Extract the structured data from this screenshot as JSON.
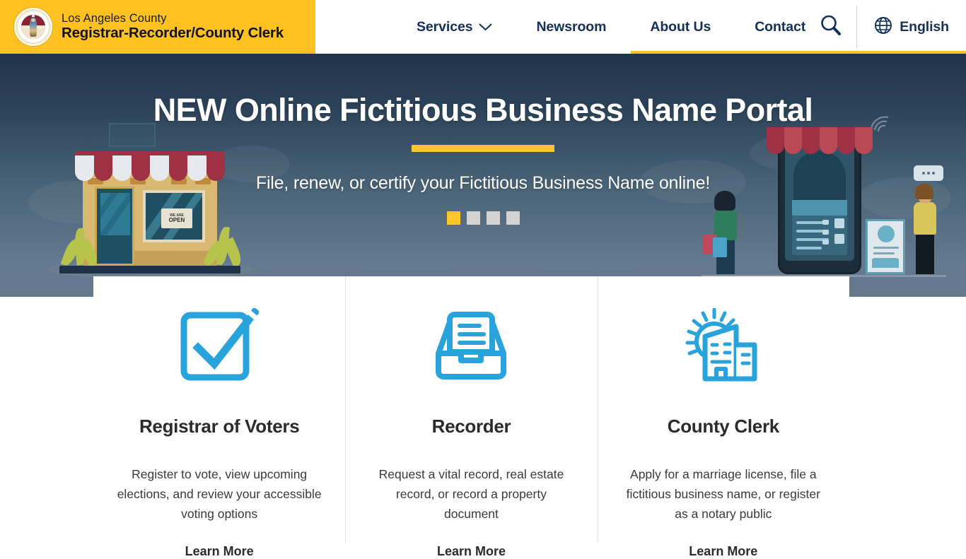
{
  "header": {
    "logo": {
      "icon": "la-county-seal",
      "alt": "Los Angeles County Seal"
    },
    "brand_line1": "Los Angeles County",
    "brand_line2": "Registrar-Recorder/County Clerk",
    "nav": [
      {
        "label": "Services",
        "has_dropdown": true
      },
      {
        "label": "Newsroom",
        "has_dropdown": false
      },
      {
        "label": "About Us",
        "has_dropdown": false
      },
      {
        "label": "Contact",
        "has_dropdown": false
      }
    ],
    "search_icon": "search-icon",
    "language": {
      "icon": "globe-icon",
      "label": "English"
    },
    "brand_bg": "#FFC220",
    "nav_text_color": "#13315c"
  },
  "hero": {
    "title": "NEW Online Fictitious Business Name Portal",
    "subtitle": "File, renew, or certify your Fictitious Business Name online!",
    "accent_bar_color": "#FFC72C",
    "slides_total": 4,
    "active_slide": 1,
    "storefront_sign_small": "WE ARE",
    "storefront_sign_big": "OPEN",
    "gradient_top": "#21344a",
    "gradient_bottom": "#65798d"
  },
  "cards": [
    {
      "icon": "checkbox-check-icon",
      "title": "Registrar of Voters",
      "description": "Register to vote, view upcoming elections, and review your accessible voting options",
      "link": "Learn More"
    },
    {
      "icon": "file-tray-document-icon",
      "title": "Recorder",
      "description": "Request a vital record, real estate record, or record a property document",
      "link": "Learn More"
    },
    {
      "icon": "sun-buildings-icon",
      "title": "County Clerk",
      "description": "Apply for a marriage license, file a fictitious business name, or register as a notary public",
      "link": "Learn More"
    }
  ],
  "theme": {
    "icon_blue": "#29A3DC",
    "gold": "#FFC72C",
    "navy": "#13315c"
  }
}
